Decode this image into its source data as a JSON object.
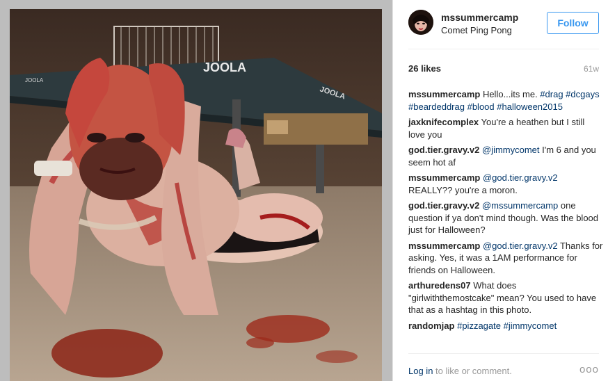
{
  "post": {
    "username": "mssummercamp",
    "location": "Comet Ping Pong",
    "follow_label": "Follow",
    "likes": "26 likes",
    "age": "61w",
    "photo_sign_1": "JOOLA",
    "photo_sign_2": "JOOLA",
    "photo_sign_3": "JOOLA",
    "comments": [
      {
        "author": "mssummercamp",
        "parts": [
          {
            "text": " Hello...its me. ",
            "tag": false
          },
          {
            "text": "#drag",
            "tag": true
          },
          {
            "text": " ",
            "tag": false
          },
          {
            "text": "#dcgays",
            "tag": true
          },
          {
            "text": " ",
            "tag": false
          },
          {
            "text": "#beardeddrag",
            "tag": true
          },
          {
            "text": " ",
            "tag": false
          },
          {
            "text": "#blood",
            "tag": true
          },
          {
            "text": " ",
            "tag": false
          },
          {
            "text": "#halloween2015",
            "tag": true
          }
        ]
      },
      {
        "author": "jaxknifecomplex",
        "parts": [
          {
            "text": " You're a heathen but I still love you",
            "tag": false
          }
        ]
      },
      {
        "author": "god.tier.gravy.v2",
        "parts": [
          {
            "text": " ",
            "tag": false
          },
          {
            "text": "@jimmycomet",
            "tag": true
          },
          {
            "text": " I'm 6 and you seem hot af",
            "tag": false
          }
        ]
      },
      {
        "author": "mssummercamp",
        "parts": [
          {
            "text": " ",
            "tag": false
          },
          {
            "text": "@god.tier.gravy.v2",
            "tag": true
          },
          {
            "text": " REALLY?? you're a moron.",
            "tag": false
          }
        ]
      },
      {
        "author": "god.tier.gravy.v2",
        "parts": [
          {
            "text": " ",
            "tag": false
          },
          {
            "text": "@mssummercamp",
            "tag": true
          },
          {
            "text": " one question if ya don't mind though. Was the blood just for Halloween?",
            "tag": false
          }
        ]
      },
      {
        "author": "mssummercamp",
        "parts": [
          {
            "text": " ",
            "tag": false
          },
          {
            "text": "@god.tier.gravy.v2",
            "tag": true
          },
          {
            "text": " Thanks for asking. Yes, it was a 1AM performance for friends on Halloween.",
            "tag": false
          }
        ]
      },
      {
        "author": "arthuredens07",
        "parts": [
          {
            "text": " What does \"girlwiththemostcake\" mean? You used to have that as a hashtag in this photo.",
            "tag": false
          }
        ]
      },
      {
        "author": "randomjap",
        "parts": [
          {
            "text": " ",
            "tag": false
          },
          {
            "text": "#pizzagate",
            "tag": true
          },
          {
            "text": " ",
            "tag": false
          },
          {
            "text": "#jimmycomet",
            "tag": true
          }
        ]
      }
    ],
    "login_link": "Log in",
    "login_suffix": " to like or comment.",
    "more_label": "ooo"
  },
  "colors": {
    "link": "#003569",
    "follow": "#3897f0",
    "muted": "#999999"
  }
}
